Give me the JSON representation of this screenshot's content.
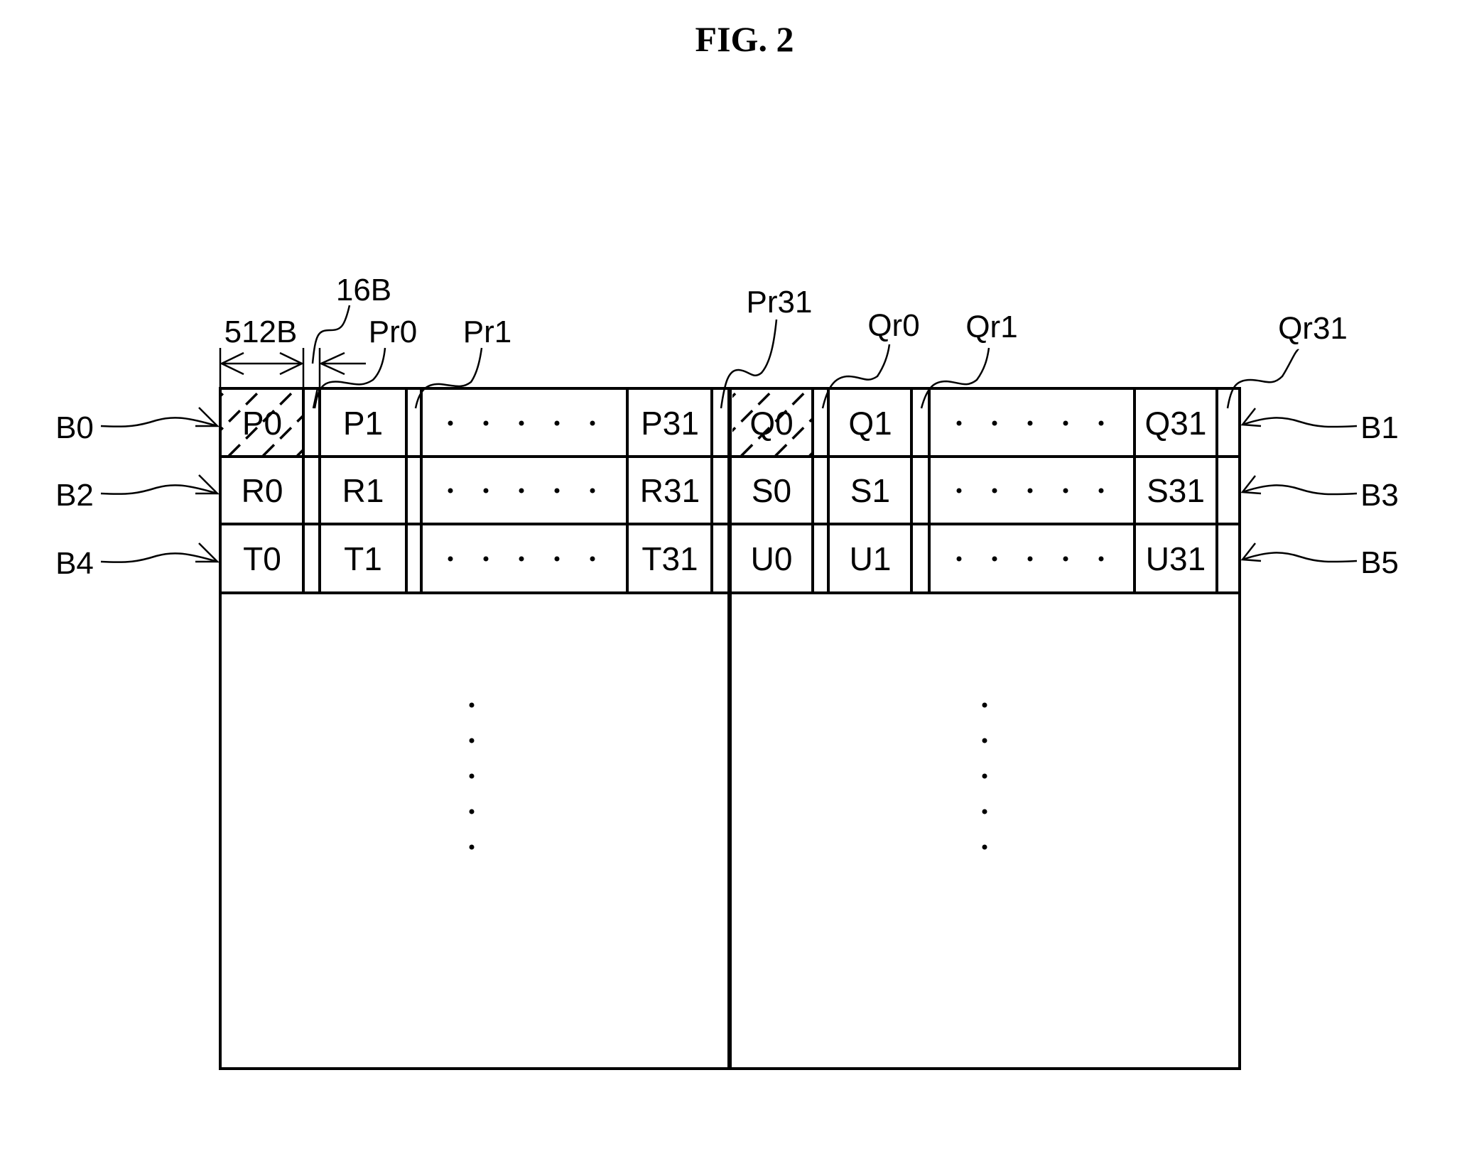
{
  "figure": {
    "title": "FIG. 2"
  },
  "dimensions": {
    "page_size": "512B",
    "spare_size": "16B"
  },
  "left_block": {
    "rows": [
      {
        "arrow_label": "B0",
        "first": "P0",
        "second": "P1",
        "last": "P31",
        "first_hatched": true
      },
      {
        "arrow_label": "B2",
        "first": "R0",
        "second": "R1",
        "last": "R31",
        "first_hatched": false
      },
      {
        "arrow_label": "B4",
        "first": "T0",
        "second": "T1",
        "last": "T31",
        "first_hatched": false
      }
    ],
    "spare_labels": [
      "Pr0",
      "Pr1",
      "Pr31"
    ],
    "ellipsis": "· · · · ·"
  },
  "right_block": {
    "rows": [
      {
        "arrow_label": "B1",
        "first": "Q0",
        "second": "Q1",
        "last": "Q31",
        "first_hatched": true
      },
      {
        "arrow_label": "B3",
        "first": "S0",
        "second": "S1",
        "last": "S31",
        "first_hatched": false
      },
      {
        "arrow_label": "B5",
        "first": "U0",
        "second": "U1",
        "last": "U31",
        "first_hatched": false
      }
    ],
    "spare_labels": [
      "Qr0",
      "Qr1",
      "Qr31"
    ],
    "ellipsis": "· · · · ·"
  },
  "vertical_ellipsis_count": 5
}
